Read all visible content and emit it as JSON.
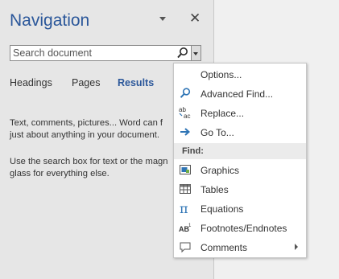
{
  "pane": {
    "title": "Navigation",
    "search": {
      "placeholder": "Search document"
    },
    "tabs": [
      {
        "label": "Headings",
        "active": false
      },
      {
        "label": "Pages",
        "active": false
      },
      {
        "label": "Results",
        "active": true
      }
    ],
    "body": {
      "line1": "Text, comments, pictures... Word can f",
      "line2": "just about anything in your document.",
      "line3": "Use the search box for text or the magn",
      "line4": "glass for everything else."
    }
  },
  "menu": {
    "items": [
      {
        "label": "Options...",
        "icon": "none"
      },
      {
        "label": "Advanced Find...",
        "icon": "magnifier-icon"
      },
      {
        "label": "Replace...",
        "icon": "replace-icon"
      },
      {
        "label": "Go To...",
        "icon": "arrow-right-icon"
      }
    ],
    "find_header": "Find:",
    "find_items": [
      {
        "label": "Graphics",
        "icon": "graphics-icon"
      },
      {
        "label": "Tables",
        "icon": "table-icon"
      },
      {
        "label": "Equations",
        "icon": "pi-icon"
      },
      {
        "label": "Footnotes/Endnotes",
        "icon": "footnote-icon"
      },
      {
        "label": "Comments",
        "icon": "comment-icon",
        "submenu": true
      }
    ]
  },
  "icon_glyphs": {
    "close": "✕",
    "replace_top": "ab",
    "replace_bottom": "ac",
    "pi": "π",
    "footnote": "AB"
  },
  "colors": {
    "accent": "#2b579a",
    "pane_bg": "#e6e6e6",
    "menu_bg": "#ffffff",
    "icon_blue": "#2e74b5"
  }
}
